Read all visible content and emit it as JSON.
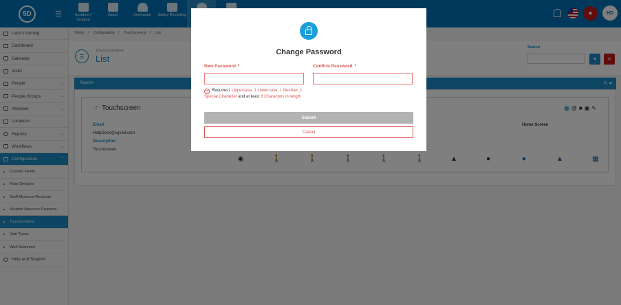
{
  "topbar": {
    "logo": "5D",
    "modules": [
      {
        "label": "Accident / Incident"
      },
      {
        "label": "Asset"
      },
      {
        "label": "Contractor"
      },
      {
        "label": "Safety Reporting"
      }
    ],
    "avatar": "HD"
  },
  "sidebar": {
    "items": [
      {
        "label": "Liam's training"
      },
      {
        "label": "Dashboard"
      },
      {
        "label": "Calendar"
      },
      {
        "label": "Visits"
      },
      {
        "label": "People"
      },
      {
        "label": "People Groups"
      },
      {
        "label": "Absence"
      },
      {
        "label": "Locations"
      },
      {
        "label": "Reports"
      },
      {
        "label": "Workflows"
      },
      {
        "label": "Configuration"
      },
      {
        "label": "Custom Fields"
      },
      {
        "label": "Pass Designs"
      },
      {
        "label": "Staff Absence Reasons"
      },
      {
        "label": "Student Absence Reasons"
      },
      {
        "label": "Touchscreens"
      },
      {
        "label": "Visit Types"
      },
      {
        "label": "Wall Scanners"
      },
      {
        "label": "Help and Support"
      }
    ]
  },
  "breadcrumb": {
    "c1": "Visitor",
    "c2": "Configuration",
    "c3": "Touchscreens",
    "c4": "List"
  },
  "page": {
    "subtitle": "TOUCHSCREENS",
    "title": "List",
    "search_label": "Search"
  },
  "results": {
    "header": "Results",
    "card_title": "Touchscreen",
    "email_label": "Email",
    "email_value": "HelpDesk@sgv5d.com",
    "description_label": "Description",
    "description_value": "Touchscreen",
    "home_screen_label": "Home Screen"
  },
  "modal": {
    "title": "Change Password",
    "new_password_label": "New Password",
    "confirm_password_label": "Confirm Password",
    "required_mark": "*",
    "req_prefix": "Requires",
    "req_part1": "1 Uppercase, 1 Lowercase, 1 Number, 1 Special Character",
    "req_mid": " and at least ",
    "req_part2": "8 Characters in length",
    "submit_label": "Submit",
    "cancel_label": "Cancel"
  },
  "colors": {
    "brand": "#0073b7",
    "accent": "#1a8bc5",
    "error": "#d9534f"
  }
}
